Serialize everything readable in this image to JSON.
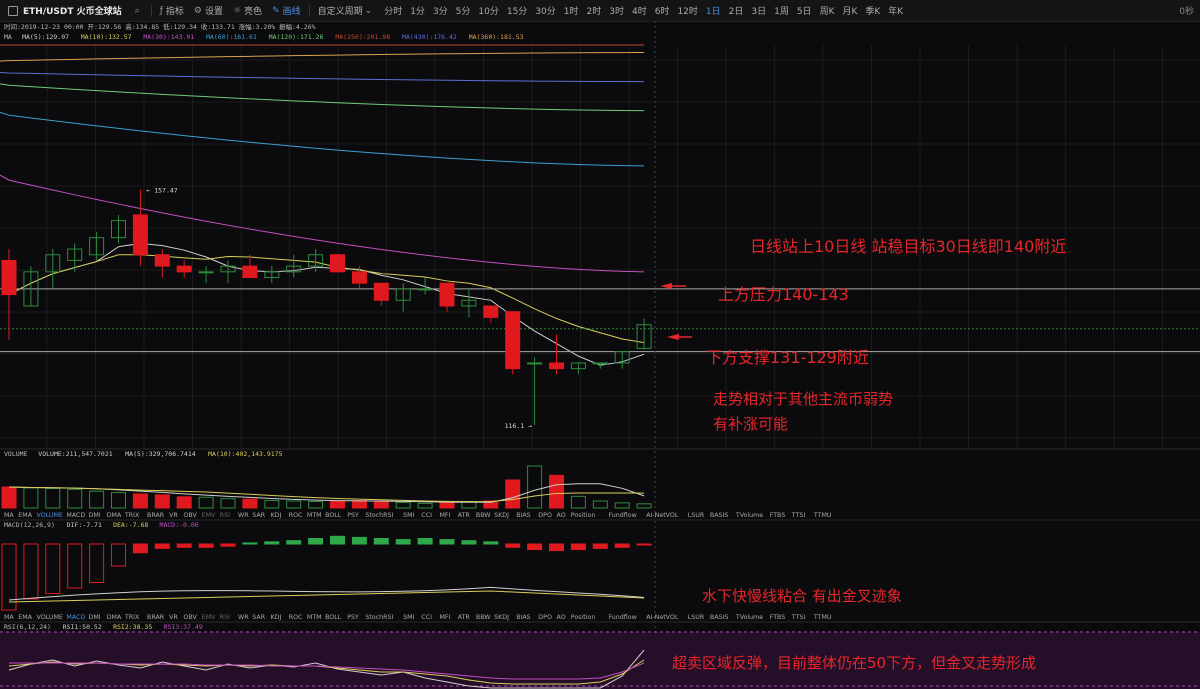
{
  "header": {
    "symbol": "ETH/USDT 火币全球站",
    "tools": [
      "指标",
      "设置",
      "亮色",
      "画线",
      "自定义周期"
    ],
    "intervals": [
      "分时",
      "1分",
      "3分",
      "5分",
      "10分",
      "15分",
      "30分",
      "1时",
      "2时",
      "3时",
      "4时",
      "6时",
      "12时",
      "1日",
      "2日",
      "3日",
      "1周",
      "5日",
      "周K",
      "月K",
      "季K",
      "年K"
    ],
    "active_interval": "1日",
    "right_label": "0秒",
    "ohlc_line": "时间:2019-12-23 00:00  开:129.56  高:134.85  低:129.34  收:133.71  涨幅:3.20%  振幅:4.26%"
  },
  "ma_legend": [
    "MA",
    "MA(5):129.07",
    "MA(10):132.57",
    "MA(30):143.01",
    "MA(60):161.61",
    "MA(120):171.26",
    "MA(250):201.98",
    "MA(430):176.42",
    "MA(360):181.53"
  ],
  "volume_legend": [
    "VOLUME",
    "VOLUME:211,547.7021",
    "MA(5):329,706.7414",
    "MA(10):402,143.9175"
  ],
  "macd_legend": [
    "MACD(12,26,9)",
    "DIF:-7.71",
    "DEA:-7.68",
    "MACD:-0.06"
  ],
  "rsi_legend": [
    "RSI(6,12,24)",
    "RSI1:50.52",
    "RSI2:38.35",
    "RSI3:37.49"
  ],
  "indicator_tabs": [
    "MA",
    "EMA",
    "VOLUME",
    "MACD",
    "DMI",
    "DMA",
    "TRIX",
    "BRAR",
    "VR",
    "OBV",
    "EMV",
    "RSI",
    "WR",
    "SAR",
    "KDJ",
    "ROC",
    "MTM",
    "BOLL",
    "PSY",
    "StochRSI",
    "SMI",
    "CCI",
    "MFI",
    "ATR",
    "BBW",
    "SKDJ",
    "BIAS",
    "DPO",
    "AO",
    "Position",
    "Fundflow",
    "AI-NetVOL",
    "LSUR",
    "BASIS",
    "TVolume",
    "FTBS",
    "TTSI",
    "TTMU"
  ],
  "price_labels": {
    "high": "157.47",
    "low": "116.1"
  },
  "annotations": [
    "日线站上10日线  站稳目标30日线即140附近",
    "上方压力140-143",
    "下方支撑131-129附近",
    "走势相对于其他主流币弱势",
    "有补涨可能",
    "水下快慢线粘合  有出金叉迹象",
    "超卖区域反弹，目前整体仍在50下方，但金叉走势形成"
  ],
  "colors": {
    "up": "#2e8b3c",
    "down": "#e0191f",
    "annotation": "#e8262a",
    "ma5": "#cfcfcf",
    "ma10": "#d8cf5a",
    "ma30": "#c34fc3",
    "ma60": "#3a9fd0",
    "ma120": "#6fcb77",
    "ma250": "#c7452c",
    "ma430": "#5b6fd6",
    "ma360": "#d8a24a"
  },
  "chart_data": {
    "type": "candlestick",
    "candles": [
      {
        "o": 145,
        "h": 147,
        "l": 131,
        "c": 139
      },
      {
        "o": 137,
        "h": 144,
        "l": 137,
        "c": 143
      },
      {
        "o": 143,
        "h": 147,
        "l": 140,
        "c": 146
      },
      {
        "o": 145,
        "h": 148,
        "l": 143,
        "c": 147
      },
      {
        "o": 146,
        "h": 150,
        "l": 145,
        "c": 149
      },
      {
        "o": 149,
        "h": 153,
        "l": 148,
        "c": 152
      },
      {
        "o": 153,
        "h": 157.47,
        "l": 144,
        "c": 146
      },
      {
        "o": 146,
        "h": 147,
        "l": 142,
        "c": 144
      },
      {
        "o": 144,
        "h": 145,
        "l": 142,
        "c": 143
      },
      {
        "o": 143,
        "h": 144,
        "l": 141,
        "c": 143
      },
      {
        "o": 143,
        "h": 145,
        "l": 141,
        "c": 144
      },
      {
        "o": 144,
        "h": 146,
        "l": 142,
        "c": 142
      },
      {
        "o": 142,
        "h": 144,
        "l": 141,
        "c": 143
      },
      {
        "o": 143,
        "h": 146,
        "l": 142,
        "c": 144
      },
      {
        "o": 144,
        "h": 147,
        "l": 143,
        "c": 146
      },
      {
        "o": 146,
        "h": 146,
        "l": 143,
        "c": 143
      },
      {
        "o": 143,
        "h": 144,
        "l": 140,
        "c": 141
      },
      {
        "o": 141,
        "h": 141,
        "l": 137,
        "c": 138
      },
      {
        "o": 138,
        "h": 141,
        "l": 136,
        "c": 140
      },
      {
        "o": 140,
        "h": 142,
        "l": 139,
        "c": 140
      },
      {
        "o": 141,
        "h": 141,
        "l": 136,
        "c": 137
      },
      {
        "o": 137,
        "h": 140,
        "l": 135,
        "c": 138
      },
      {
        "o": 137,
        "h": 137,
        "l": 134,
        "c": 135
      },
      {
        "o": 136,
        "h": 136,
        "l": 125,
        "c": 126
      },
      {
        "o": 127,
        "h": 128,
        "l": 116.1,
        "c": 127
      },
      {
        "o": 127,
        "h": 132,
        "l": 125,
        "c": 126
      },
      {
        "o": 126,
        "h": 127,
        "l": 125,
        "c": 127
      },
      {
        "o": 127,
        "h": 127,
        "l": 126,
        "c": 127
      },
      {
        "o": 127,
        "h": 129,
        "l": 126,
        "c": 129
      },
      {
        "o": 129.56,
        "h": 134.85,
        "l": 129.34,
        "c": 133.71
      }
    ],
    "volume": [
      450,
      430,
      420,
      400,
      360,
      330,
      300,
      280,
      240,
      230,
      200,
      190,
      160,
      150,
      140,
      150,
      160,
      140,
      120,
      100,
      110,
      140,
      150,
      600,
      900,
      700,
      250,
      150,
      110,
      90
    ],
    "macd_hist": [
      -6,
      -5,
      -4.5,
      -4,
      -3.5,
      -2,
      -0.8,
      -0.4,
      -0.3,
      -0.3,
      -0.2,
      0.1,
      0.2,
      0.3,
      0.5,
      0.7,
      0.6,
      0.5,
      0.4,
      0.5,
      0.4,
      0.3,
      0.2,
      -0.3,
      -0.5,
      -0.6,
      -0.5,
      -0.4,
      -0.3,
      -0.06
    ],
    "hlines": [
      140,
      133,
      129
    ],
    "ylim": [
      114,
      160
    ]
  }
}
